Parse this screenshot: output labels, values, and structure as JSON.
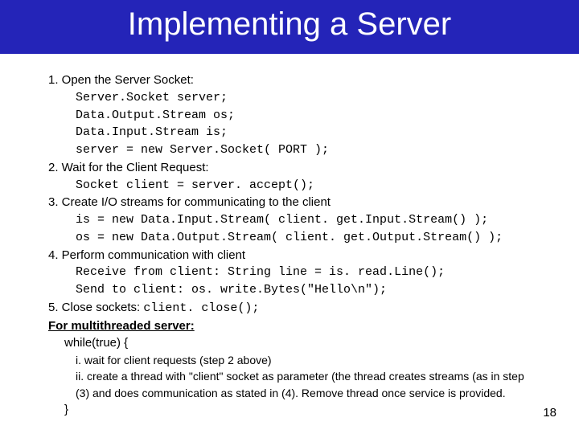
{
  "title": "Implementing a Server",
  "steps": {
    "s1": "1. Open the Server Socket:",
    "s1_code": "Server.Socket server;\nData.Output.Stream os;\nData.Input.Stream is;\nserver = new Server.Socket( PORT );",
    "s2": "2. Wait for the Client Request:",
    "s2_code": "Socket client = server. accept();",
    "s3": "3. Create I/O streams for communicating to the client",
    "s3_code": "is = new Data.Input.Stream( client. get.Input.Stream() );\nos = new Data.Output.Stream( client. get.Output.Stream() );",
    "s4": "4. Perform communication with client",
    "s4_code": "Receive from client: String line = is. read.Line();\nSend to client: os. write.Bytes(\"Hello\\n\");",
    "s5_label": "5. Close sockets:   ",
    "s5_code": "client. close();",
    "mt_heading": "For multithreaded server:",
    "while_open": "while(true) {",
    "sub_i": "i. wait for client requests (step 2 above)",
    "sub_ii": "ii. create a thread with \"client\" socket as parameter (the thread creates streams (as in step (3) and does communication as stated in (4). Remove thread once service is provided.",
    "while_close": "}"
  },
  "page_number": "18"
}
